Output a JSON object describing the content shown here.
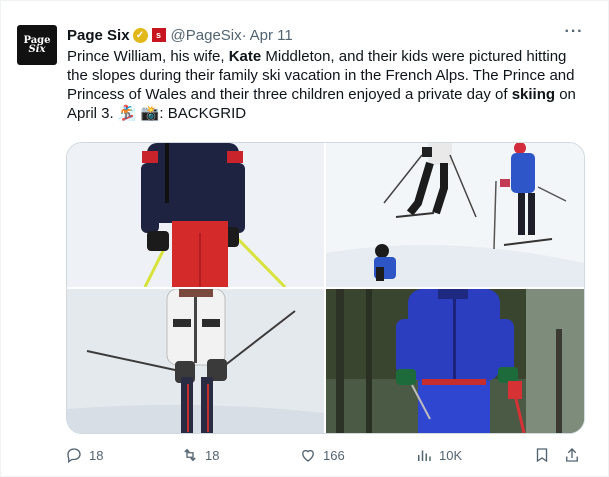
{
  "account": {
    "avatar_line1": "Page",
    "avatar_line2": "Six",
    "name": "Page Six",
    "handle": "@PageSix",
    "separator": "·",
    "date": "Apr 11"
  },
  "tweet": {
    "t1": "Prince William, his wife, ",
    "t2": "Kate",
    "t3": " Middleton, and their kids were pictured hitting the slopes during their family ski vacation in the French Alps. The Prince and Princess of Wales and their three children enjoyed a private day of ",
    "t4": "skiing",
    "t5": " on April 3. ",
    "emoji1": "🏂",
    "emoji2": "📸",
    "t6": ": BACKGRID"
  },
  "actions": {
    "replies": "18",
    "reposts": "18",
    "likes": "166",
    "views": "10K"
  },
  "icons": {
    "more": "more-horizontal-icon",
    "verified": "verified-badge-icon",
    "affiliate": "affiliate-badge-icon",
    "reply": "reply-icon",
    "repost": "repost-icon",
    "like": "heart-icon",
    "views": "views-icon",
    "bookmark": "bookmark-icon",
    "share": "share-icon"
  },
  "colors": {
    "verified_gold": "#e2b719",
    "affiliate_red": "#c7161f",
    "muted_text": "#536471"
  }
}
